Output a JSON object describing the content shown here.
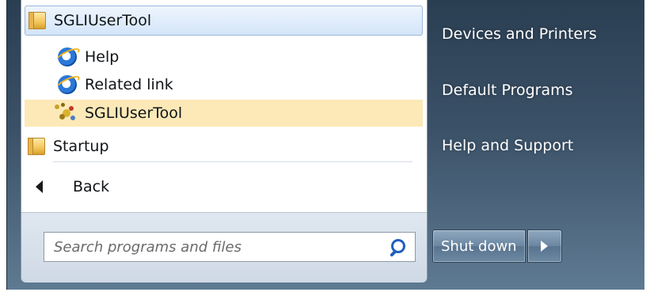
{
  "start_menu": {
    "program_list": [
      {
        "label": "SGLIUserTool",
        "icon": "folder-icon",
        "state": "hover"
      },
      {
        "label": "Help",
        "icon": "ie-icon"
      },
      {
        "label": "Related link",
        "icon": "ie-icon"
      },
      {
        "label": "SGLIUserTool",
        "icon": "tool-icon",
        "state": "selected"
      },
      {
        "label": "Startup",
        "icon": "folder-icon"
      }
    ],
    "back_label": "Back",
    "search": {
      "placeholder": "Search programs and files"
    },
    "right_pane": {
      "items": [
        "Devices and Printers",
        "Default Programs",
        "Help and Support"
      ]
    },
    "shutdown_label": "Shut down"
  },
  "colors": {
    "right_pane_bg": "#3b5167",
    "selected_bg": "#fce9b7",
    "hover_bg": "#d3e5fa",
    "search_icon": "#1f5fbf"
  }
}
